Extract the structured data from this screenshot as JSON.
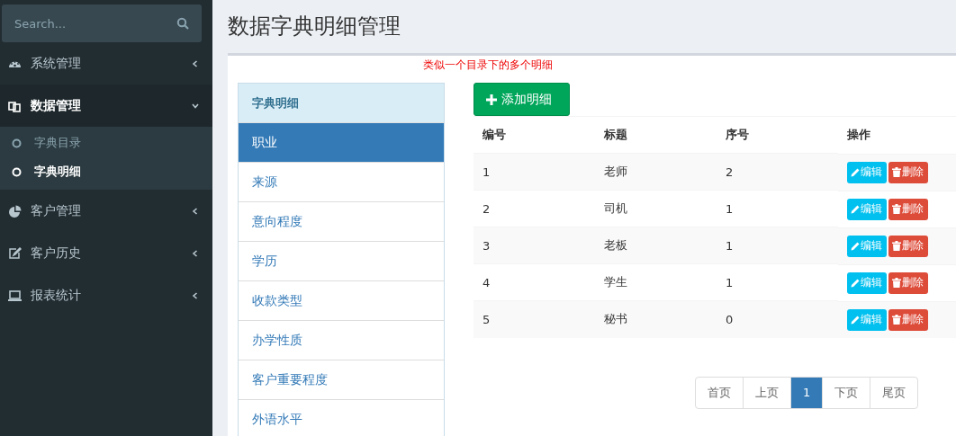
{
  "sidebar": {
    "search": {
      "placeholder": "Search..."
    },
    "items": [
      {
        "kind": "menu",
        "label": "系统管理",
        "expanded": false
      },
      {
        "kind": "menu",
        "label": "数据管理",
        "expanded": true,
        "children": [
          {
            "label": "字典目录",
            "selected": false
          },
          {
            "label": "字典明细",
            "selected": true
          }
        ]
      },
      {
        "kind": "menu",
        "label": "客户管理",
        "expanded": false
      },
      {
        "kind": "menu",
        "label": "客户历史",
        "expanded": false
      },
      {
        "kind": "menu",
        "label": "报表统计",
        "expanded": false
      }
    ]
  },
  "page_title": "数据字典明细管理",
  "note": "类似一个目录下的多个明细",
  "catalog": {
    "header": "字典明细",
    "items": [
      {
        "label": "职业",
        "selected": true
      },
      {
        "label": "来源",
        "selected": false
      },
      {
        "label": "意向程度",
        "selected": false
      },
      {
        "label": "学历",
        "selected": false
      },
      {
        "label": "收款类型",
        "selected": false
      },
      {
        "label": "办学性质",
        "selected": false
      },
      {
        "label": "客户重要程度",
        "selected": false
      },
      {
        "label": "外语水平",
        "selected": false
      }
    ]
  },
  "add_button": "添加明细",
  "table": {
    "columns": [
      "编号",
      "标题",
      "序号",
      "操作"
    ],
    "rows": [
      {
        "id": "1",
        "title": "老师",
        "order": "2",
        "edit": "编辑",
        "delete": "删除"
      },
      {
        "id": "2",
        "title": "司机",
        "order": "1",
        "edit": "编辑",
        "delete": "删除"
      },
      {
        "id": "3",
        "title": "老板",
        "order": "1",
        "edit": "编辑",
        "delete": "删除"
      },
      {
        "id": "4",
        "title": "学生",
        "order": "1",
        "edit": "编辑",
        "delete": "删除"
      },
      {
        "id": "5",
        "title": "秘书",
        "order": "0",
        "edit": "编辑",
        "delete": "删除"
      }
    ]
  },
  "pagination": [
    {
      "label": "首页",
      "selected": false
    },
    {
      "label": "上页",
      "selected": false
    },
    {
      "label": "1",
      "selected": true
    },
    {
      "label": "下页",
      "selected": false
    },
    {
      "label": "尾页",
      "selected": false
    }
  ]
}
